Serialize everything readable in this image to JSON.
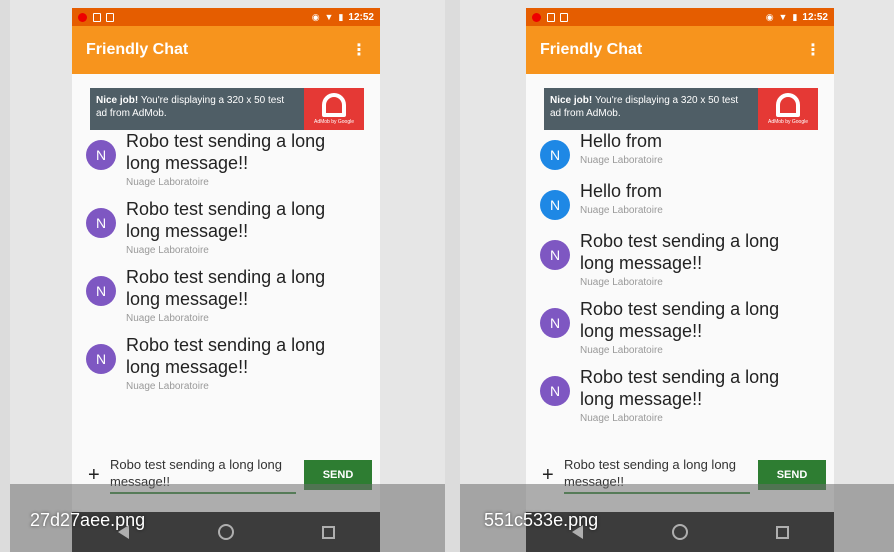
{
  "statusbar": {
    "time": "12:52"
  },
  "app": {
    "title": "Friendly Chat",
    "overflow_glyph": "⋮"
  },
  "ad": {
    "bold": "Nice job!",
    "text": " You're displaying a 320 x 50 test ad from AdMob.",
    "logo_sub": "AdMob by Google"
  },
  "composer": {
    "add_glyph": "+",
    "input_value": "Robo test sending a long long message!!",
    "send_label": "SEND"
  },
  "panels": [
    {
      "file_label": "27d27aee.png",
      "messages": [
        {
          "avatar": "N",
          "text": "Robo test sending a long long message!!",
          "name": "Nuage Laboratoire"
        },
        {
          "avatar": "N",
          "text": "Robo test sending a long long message!!",
          "name": "Nuage Laboratoire"
        },
        {
          "avatar": "N",
          "text": "Robo test sending a long long message!!",
          "name": "Nuage Laboratoire"
        },
        {
          "avatar": "N",
          "text": "Robo test sending a long long message!!",
          "name": "Nuage Laboratoire"
        }
      ]
    },
    {
      "file_label": "551c533e.png",
      "messages": [
        {
          "avatar": "N",
          "text": "Hello from",
          "name": "Nuage Laboratoire"
        },
        {
          "avatar": "N",
          "text": "Hello from",
          "name": "Nuage Laboratoire"
        },
        {
          "avatar": "N",
          "text": "Robo test sending a long long message!!",
          "name": "Nuage Laboratoire"
        },
        {
          "avatar": "N",
          "text": "Robo test sending a long long message!!",
          "name": "Nuage Laboratoire"
        },
        {
          "avatar": "N",
          "text": "Robo test sending a long long message!!",
          "name": "Nuage Laboratoire"
        }
      ]
    }
  ],
  "colors": {
    "statusbar": "#e55d00",
    "appbar": "#f7941d",
    "avatar_purple": "#7e57c2",
    "avatar_blue": "#1e88e5",
    "send_button": "#2e7d32"
  }
}
